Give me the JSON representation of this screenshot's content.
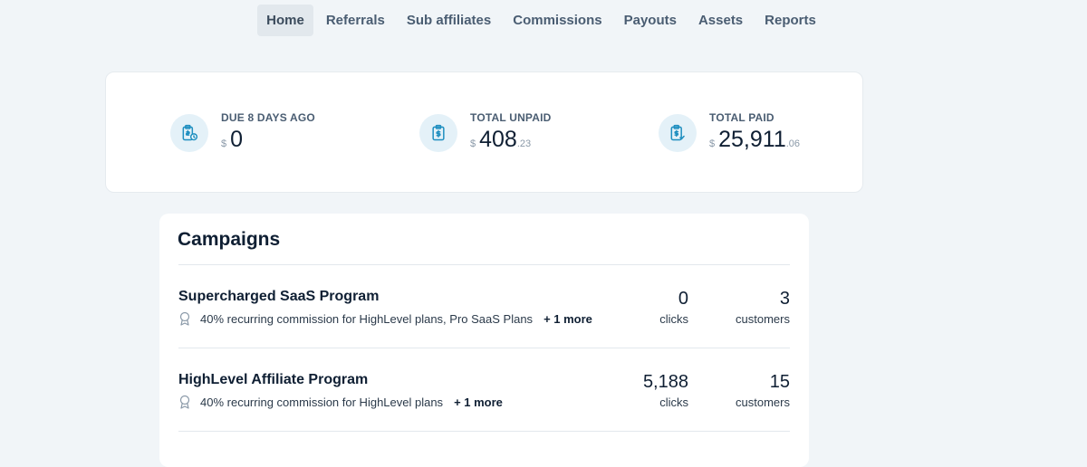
{
  "nav": {
    "items": [
      "Home",
      "Referrals",
      "Sub affiliates",
      "Commissions",
      "Payouts",
      "Assets",
      "Reports"
    ],
    "active": "Home"
  },
  "stats": [
    {
      "label": "DUE 8 DAYS AGO",
      "currency": "$",
      "amount": "0",
      "cents": "",
      "icon": "clipboard-clock-icon"
    },
    {
      "label": "TOTAL UNPAID",
      "currency": "$",
      "amount": "408",
      "cents": ".23",
      "icon": "clipboard-dollar-icon"
    },
    {
      "label": "TOTAL PAID",
      "currency": "$",
      "amount": "25,911",
      "cents": ".06",
      "icon": "clipboard-check-dollar-icon"
    }
  ],
  "campaigns": {
    "title": "Campaigns",
    "items": [
      {
        "name": "Supercharged SaaS Program",
        "description": "40% recurring commission for HighLevel plans, Pro SaaS Plans",
        "more": "+ 1 more",
        "clicks": "0",
        "clicks_label": "clicks",
        "customers": "3",
        "customers_label": "customers"
      },
      {
        "name": "HighLevel Affiliate Program",
        "description": "40% recurring commission for HighLevel plans",
        "more": "+ 1 more",
        "clicks": "5,188",
        "clicks_label": "clicks",
        "customers": "15",
        "customers_label": "customers"
      }
    ]
  },
  "colors": {
    "background": "#f1f5f8",
    "card": "#ffffff",
    "icon_bg": "#e4f1f8",
    "icon_stroke": "#1f8fc0",
    "text_dark": "#0f1f33",
    "nav_text": "#4a5d72"
  }
}
